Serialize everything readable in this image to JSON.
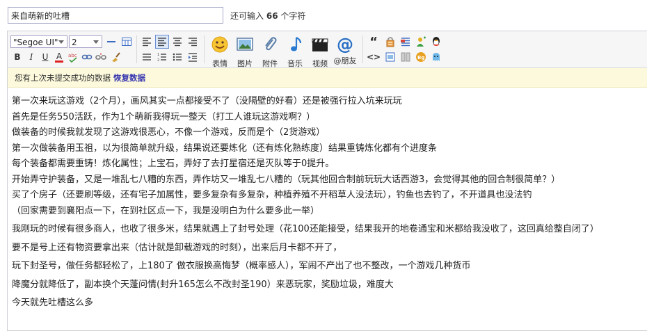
{
  "title_field": {
    "value": "来自萌新的吐槽"
  },
  "char_count": {
    "prefix": "还可输入",
    "count": "66",
    "suffix": "个字符"
  },
  "toolbar": {
    "font_family": "\"Segoe UI\"",
    "font_size": "2",
    "buttons": {
      "emoji": "表情",
      "image": "图片",
      "attachment": "附件",
      "music": "音乐",
      "video": "视频",
      "mention": "@朋友"
    },
    "mention_glyph": "@",
    "format_labels": {
      "bold": "B",
      "italic": "I",
      "underline": "U",
      "color": "A"
    },
    "quote_glyph": "“",
    "code_glyph": "<>"
  },
  "notice": {
    "text": "您有上次未提交成功的数据",
    "link": "恢复数据"
  },
  "content": {
    "lines": [
      "第一次来玩这游戏（2个月），画风其实一点都接受不了（没隔壁的好看）还是被强行拉入坑来玩玩",
      "首先是任务550活跃，作为1个萌新我得玩一整天（打工人谁玩这游戏啊？）",
      "做装备的时候我就发现了这游戏很恶心，不像一个游戏，反而是个（2货游戏）",
      "第一次做装备用玉祖，以为很简单就升级，结果说还要炼化（还有炼化熟练度）结果重铸炼化都有个进度条",
      "每个装备都需要重铸！炼化属性；上宝石，弄好了去打星宿还是灭队等于0提升。",
      "开始弄守护装备，又是一堆乱七八糟的东西，弄作坊又一堆乱七八糟的（玩其他回合制前玩玩大话西游3，会觉得其他的回合制很简单？）",
      "买了个房子（还要刷等级，还有宅子加属性，要多复杂有多复杂，种植养殖不开稻草人没法玩），钓鱼也去钓了，不开道具也没法钓",
      "（回家需要到襄阳点一下，在到社区点一下，我是没明白为什么要多此一举）",
      "我刚玩的时候有很多商人，也收了很多米，结果就遇上了封号处理（花100还能接受，结果我开的地卷通宝和米都给我没收了，这回真给整自闭了）",
      "要不是号上还有物资要拿出来（估计就是卸载游戏的时刻），出来后月卡都不开了，",
      "玩下封圣号，做任务都轻松了，上180了 做衣服换高悔梦（概率感人），军闹不产出了也不整改，一个游戏几种货币",
      "降魔分就降低了，副本换个天蓬问情(封升165怎么不改封圣190）来恶玩家，奖励垃圾，难度大",
      "今天就先吐槽这么多"
    ]
  },
  "colors": {
    "accent": "#5a2d82",
    "link": "#3a3ab0",
    "notice_bg": "#fdf9dc"
  }
}
